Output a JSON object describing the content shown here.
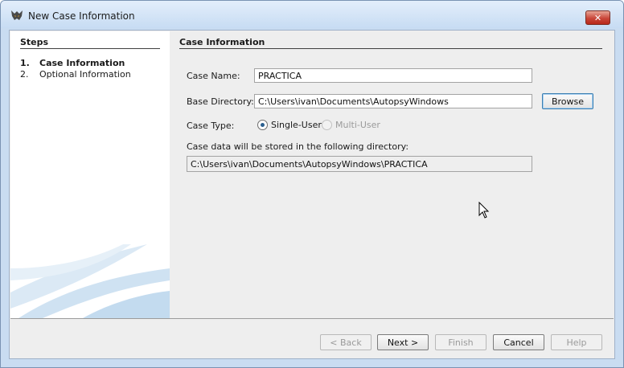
{
  "window": {
    "title": "New Case Information",
    "close_label": "✕"
  },
  "steps": {
    "header": "Steps",
    "items": [
      {
        "number": "1.",
        "label": "Case Information"
      },
      {
        "number": "2.",
        "label": "Optional Information"
      }
    ]
  },
  "form": {
    "header": "Case Information",
    "case_name_label": "Case Name:",
    "case_name_value": "PRACTICA",
    "base_dir_label": "Base Directory:",
    "base_dir_value": "C:\\Users\\ivan\\Documents\\AutopsyWindows",
    "browse_label": "Browse",
    "case_type_label": "Case Type:",
    "case_type_options": [
      {
        "label": "Single-User",
        "selected": true,
        "enabled": true
      },
      {
        "label": "Multi-User",
        "selected": false,
        "enabled": false
      }
    ],
    "storage_note": "Case data will be stored in the following directory:",
    "storage_path": "C:\\Users\\ivan\\Documents\\AutopsyWindows\\PRACTICA"
  },
  "footer": {
    "back_label": "< Back",
    "next_label": "Next >",
    "finish_label": "Finish",
    "cancel_label": "Cancel",
    "help_label": "Help"
  }
}
